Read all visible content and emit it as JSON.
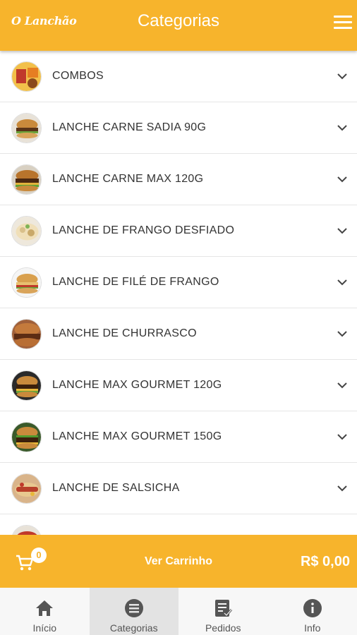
{
  "header": {
    "logo": "O Lanchão",
    "title": "Categorias"
  },
  "categories": [
    {
      "label": "COMBOS",
      "icon": "combos-thumb"
    },
    {
      "label": "LANCHE CARNE SADIA 90G",
      "icon": "burger-thumb"
    },
    {
      "label": "LANCHE CARNE MAX 120G",
      "icon": "burger-thumb"
    },
    {
      "label": "LANCHE DE FRANGO DESFIADO",
      "icon": "chicken-thumb"
    },
    {
      "label": "LANCHE DE FILÉ DE FRANGO",
      "icon": "burger-thumb"
    },
    {
      "label": "LANCHE DE CHURRASCO",
      "icon": "churrasco-thumb"
    },
    {
      "label": "LANCHE MAX GOURMET 120G",
      "icon": "burger-thumb"
    },
    {
      "label": "LANCHE MAX GOURMET 150G",
      "icon": "burger-thumb"
    },
    {
      "label": "LANCHE DE SALSICHA",
      "icon": "hotdog-thumb"
    }
  ],
  "cart": {
    "count": "0",
    "label": "Ver Carrinho",
    "total": "R$ 0,00"
  },
  "nav": [
    {
      "label": "Início",
      "icon": "home-icon"
    },
    {
      "label": "Categorias",
      "icon": "list-icon"
    },
    {
      "label": "Pedidos",
      "icon": "orders-icon"
    },
    {
      "label": "Info",
      "icon": "info-icon"
    }
  ],
  "colors": {
    "accent": "#f7b42c",
    "text": "#333333"
  }
}
